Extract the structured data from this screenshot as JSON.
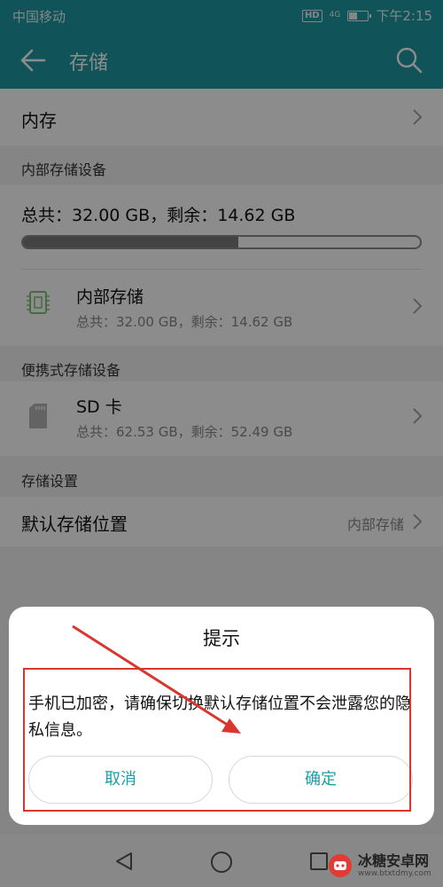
{
  "status": {
    "carrier": "中国移动",
    "hd": "HD",
    "signal": "4G",
    "time": "下午2:15"
  },
  "header": {
    "title": "存储"
  },
  "memory": {
    "label": "内存"
  },
  "internal_section": {
    "label": "内部存储设备"
  },
  "internal_summary": {
    "text": "总共：32.00 GB，剩余：14.62 GB",
    "usage_fraction": 0.543
  },
  "internal_item": {
    "title": "内部存储",
    "subtitle": "总共：32.00 GB，剩余：14.62 GB"
  },
  "portable_section": {
    "label": "便携式存储设备"
  },
  "sd_item": {
    "title": "SD 卡",
    "subtitle": "总共：62.53 GB，剩余：52.49 GB"
  },
  "settings_section": {
    "label": "存储设置"
  },
  "default_location": {
    "label": "默认存储位置",
    "value": "内部存储"
  },
  "dialog": {
    "title": "提示",
    "message": "手机已加密，请确保切换默认存储位置不会泄露您的隐私信息。",
    "cancel_label": "取消",
    "ok_label": "确定"
  },
  "watermark": {
    "name": "冰糖安卓网",
    "url": "www.btxtdmy.com"
  },
  "colors": {
    "accent": "#1e9aa3",
    "highlight": "#d9362d"
  },
  "icons": [
    "back-arrow-icon",
    "search-icon",
    "chevron-right-icon",
    "chip-icon",
    "sd-card-icon",
    "nav-back-icon",
    "nav-home-icon",
    "nav-recent-icon"
  ]
}
